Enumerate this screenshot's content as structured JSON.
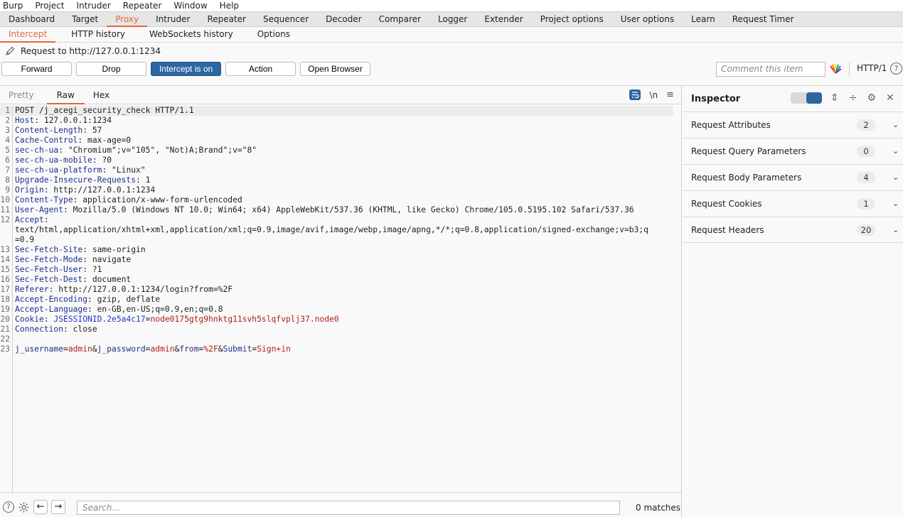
{
  "menu": [
    "Burp",
    "Project",
    "Intruder",
    "Repeater",
    "Window",
    "Help"
  ],
  "main_tabs": [
    "Dashboard",
    "Target",
    "Proxy",
    "Intruder",
    "Repeater",
    "Sequencer",
    "Decoder",
    "Comparer",
    "Logger",
    "Extender",
    "Project options",
    "User options",
    "Learn",
    "Request Timer"
  ],
  "main_tab_active": "Proxy",
  "sub_tabs": [
    "Intercept",
    "HTTP history",
    "WebSockets history",
    "Options"
  ],
  "sub_tab_active": "Intercept",
  "request_to": "Request to http://127.0.0.1:1234",
  "toolbar": {
    "forward": "Forward",
    "drop": "Drop",
    "intercept": "Intercept is on",
    "action": "Action",
    "open_browser": "Open Browser",
    "comment_placeholder": "Comment this item",
    "http_version": "HTTP/1",
    "help": "?"
  },
  "editor": {
    "tabs": [
      "Pretty",
      "Raw",
      "Hex"
    ],
    "active_tab": "Raw",
    "newline_toggle": "\\n",
    "lines": [
      {
        "n": "1",
        "parts": [
          {
            "t": "POST /j_acegi_security_check HTTP/1.1",
            "c": ""
          }
        ]
      },
      {
        "n": "2",
        "parts": [
          {
            "t": "Host",
            "c": "hn"
          },
          {
            "t": ": 127.0.0.1:1234",
            "c": ""
          }
        ]
      },
      {
        "n": "3",
        "parts": [
          {
            "t": "Content-Length",
            "c": "hn"
          },
          {
            "t": ": 57",
            "c": ""
          }
        ]
      },
      {
        "n": "4",
        "parts": [
          {
            "t": "Cache-Control",
            "c": "hn"
          },
          {
            "t": ": max-age=0",
            "c": ""
          }
        ]
      },
      {
        "n": "5",
        "parts": [
          {
            "t": "sec-ch-ua",
            "c": "hn"
          },
          {
            "t": ": \"Chromium\";v=\"105\", \"Not)A;Brand\";v=\"8\"",
            "c": ""
          }
        ]
      },
      {
        "n": "6",
        "parts": [
          {
            "t": "sec-ch-ua-mobile",
            "c": "hn"
          },
          {
            "t": ": ?0",
            "c": ""
          }
        ]
      },
      {
        "n": "7",
        "parts": [
          {
            "t": "sec-ch-ua-platform",
            "c": "hn"
          },
          {
            "t": ": \"Linux\"",
            "c": ""
          }
        ]
      },
      {
        "n": "8",
        "parts": [
          {
            "t": "Upgrade-Insecure-Requests",
            "c": "hn"
          },
          {
            "t": ": 1",
            "c": ""
          }
        ]
      },
      {
        "n": "9",
        "parts": [
          {
            "t": "Origin",
            "c": "hn"
          },
          {
            "t": ": http://127.0.0.1:1234",
            "c": ""
          }
        ]
      },
      {
        "n": "10",
        "parts": [
          {
            "t": "Content-Type",
            "c": "hn"
          },
          {
            "t": ": application/x-www-form-urlencoded",
            "c": ""
          }
        ]
      },
      {
        "n": "11",
        "parts": [
          {
            "t": "User-Agent",
            "c": "hn"
          },
          {
            "t": ": Mozilla/5.0 (Windows NT 10.0; Win64; x64) AppleWebKit/537.36 (KHTML, like Gecko) Chrome/105.0.5195.102 Safari/537.36",
            "c": ""
          }
        ]
      },
      {
        "n": "12",
        "parts": [
          {
            "t": "Accept",
            "c": "hn"
          },
          {
            "t": ":",
            "c": ""
          }
        ]
      },
      {
        "n": "",
        "parts": [
          {
            "t": "text/html,application/xhtml+xml,application/xml;q=0.9,image/avif,image/webp,image/apng,*/*;q=0.8,application/signed-exchange;v=b3;q",
            "c": ""
          }
        ]
      },
      {
        "n": "",
        "parts": [
          {
            "t": "=0.9",
            "c": ""
          }
        ]
      },
      {
        "n": "13",
        "parts": [
          {
            "t": "Sec-Fetch-Site",
            "c": "hn"
          },
          {
            "t": ": same-origin",
            "c": ""
          }
        ]
      },
      {
        "n": "14",
        "parts": [
          {
            "t": "Sec-Fetch-Mode",
            "c": "hn"
          },
          {
            "t": ": navigate",
            "c": ""
          }
        ]
      },
      {
        "n": "15",
        "parts": [
          {
            "t": "Sec-Fetch-User",
            "c": "hn"
          },
          {
            "t": ": ?1",
            "c": ""
          }
        ]
      },
      {
        "n": "16",
        "parts": [
          {
            "t": "Sec-Fetch-Dest",
            "c": "hn"
          },
          {
            "t": ": document",
            "c": ""
          }
        ]
      },
      {
        "n": "17",
        "parts": [
          {
            "t": "Referer",
            "c": "hn"
          },
          {
            "t": ": http://127.0.0.1:1234/login?from=%2F",
            "c": ""
          }
        ]
      },
      {
        "n": "18",
        "parts": [
          {
            "t": "Accept-Encoding",
            "c": "hn"
          },
          {
            "t": ": gzip, deflate",
            "c": ""
          }
        ]
      },
      {
        "n": "19",
        "parts": [
          {
            "t": "Accept-Language",
            "c": "hn"
          },
          {
            "t": ": en-GB,en-US;q=0.9,en;q=0.8",
            "c": ""
          }
        ]
      },
      {
        "n": "20",
        "parts": [
          {
            "t": "Cookie",
            "c": "hn"
          },
          {
            "t": ": ",
            "c": ""
          },
          {
            "t": "JSESSIONID.2e5a4c17",
            "c": "ckn"
          },
          {
            "t": "=",
            "c": ""
          },
          {
            "t": "node0175gtg9hnktg11svh5slqfvplj37.node0",
            "c": "pv"
          }
        ]
      },
      {
        "n": "21",
        "parts": [
          {
            "t": "Connection",
            "c": "hn"
          },
          {
            "t": ": close",
            "c": ""
          }
        ]
      },
      {
        "n": "22",
        "parts": []
      },
      {
        "n": "23",
        "parts": [
          {
            "t": "j_username",
            "c": "hn"
          },
          {
            "t": "=",
            "c": ""
          },
          {
            "t": "admin",
            "c": "pv"
          },
          {
            "t": "&",
            "c": ""
          },
          {
            "t": "j_password",
            "c": "hn"
          },
          {
            "t": "=",
            "c": ""
          },
          {
            "t": "admin",
            "c": "pv"
          },
          {
            "t": "&",
            "c": ""
          },
          {
            "t": "from",
            "c": "hn"
          },
          {
            "t": "=",
            "c": ""
          },
          {
            "t": "%2F",
            "c": "pv"
          },
          {
            "t": "&",
            "c": ""
          },
          {
            "t": "Submit",
            "c": "hn"
          },
          {
            "t": "=",
            "c": ""
          },
          {
            "t": "Sign+in",
            "c": "pv"
          }
        ]
      }
    ]
  },
  "search": {
    "placeholder": "Search...",
    "matches": "0 matches"
  },
  "inspector": {
    "title": "Inspector",
    "sections": [
      {
        "label": "Request Attributes",
        "count": "2"
      },
      {
        "label": "Request Query Parameters",
        "count": "0"
      },
      {
        "label": "Request Body Parameters",
        "count": "4"
      },
      {
        "label": "Request Cookies",
        "count": "1"
      },
      {
        "label": "Request Headers",
        "count": "20"
      }
    ]
  },
  "colors": {
    "accent": "#e8643a",
    "primary": "#2c67a1",
    "header_name": "#1d2f8e",
    "param_value": "#b01c1c"
  }
}
